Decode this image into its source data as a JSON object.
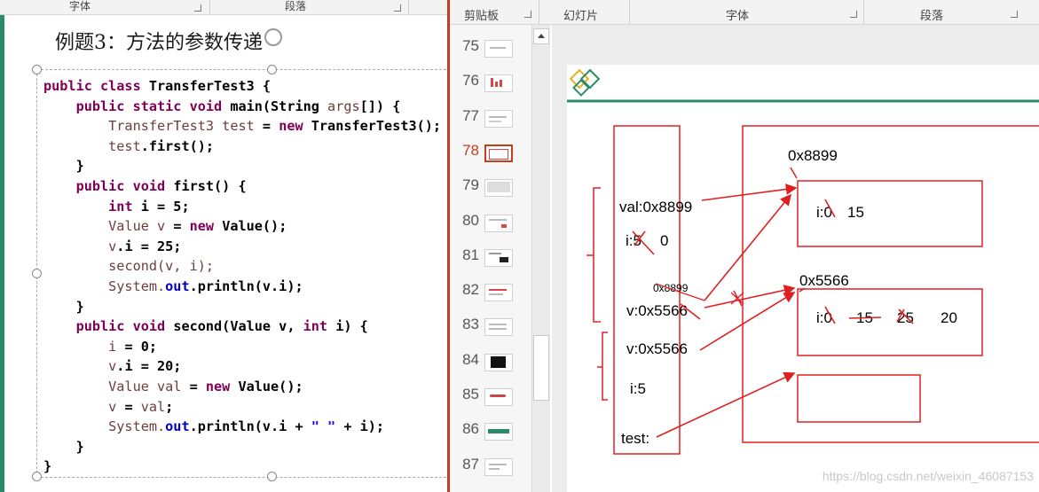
{
  "left": {
    "ribbon": {
      "font_group": "字体",
      "paragraph_group": "段落"
    },
    "title": "例题3：方法的参数传递",
    "code": [
      [
        [
          "k",
          "public class "
        ],
        [
          "n",
          "TransferTest3 {"
        ]
      ],
      [
        [
          "n",
          "    "
        ],
        [
          "k",
          "public static void "
        ],
        [
          "n",
          "main(String "
        ],
        [
          "g",
          "args"
        ],
        [
          "n",
          "[]) {"
        ]
      ],
      [
        [
          "g",
          "        TransferTest3 "
        ],
        [
          "g",
          "test"
        ],
        [
          "n",
          " = "
        ],
        [
          "k",
          "new "
        ],
        [
          "n",
          "TransferTest3();"
        ]
      ],
      [
        [
          "g",
          "        test"
        ],
        [
          "n",
          ".first();"
        ]
      ],
      [
        [
          "n",
          "    }"
        ]
      ],
      [
        [
          "n",
          "    "
        ],
        [
          "k",
          "public void "
        ],
        [
          "n",
          "first() {"
        ]
      ],
      [
        [
          "n",
          "        "
        ],
        [
          "k",
          "int "
        ],
        [
          "n",
          "i = 5;"
        ]
      ],
      [
        [
          "g",
          "        Value "
        ],
        [
          "g",
          "v"
        ],
        [
          "n",
          " = "
        ],
        [
          "k",
          "new "
        ],
        [
          "n",
          "Value();"
        ]
      ],
      [
        [
          "g",
          "        v"
        ],
        [
          "n",
          ".i = 25;"
        ]
      ],
      [
        [
          "n",
          "        "
        ],
        [
          "g",
          "second(v, i);"
        ]
      ],
      [
        [
          "g",
          "        System."
        ],
        [
          "f",
          "out"
        ],
        [
          "n",
          ".println(v.i);"
        ]
      ],
      [
        [
          "n",
          "    }"
        ]
      ],
      [
        [
          "n",
          "    "
        ],
        [
          "k",
          "public void "
        ],
        [
          "n",
          "second(Value v, "
        ],
        [
          "k",
          "int "
        ],
        [
          "n",
          "i) {"
        ]
      ],
      [
        [
          "g",
          "        i"
        ],
        [
          "n",
          " = 0;"
        ]
      ],
      [
        [
          "g",
          "        v"
        ],
        [
          "n",
          ".i = 20;"
        ]
      ],
      [
        [
          "g",
          "        Value "
        ],
        [
          "g",
          "val"
        ],
        [
          "n",
          " = "
        ],
        [
          "k",
          "new "
        ],
        [
          "n",
          "Value();"
        ]
      ],
      [
        [
          "g",
          "        v"
        ],
        [
          "n",
          " = "
        ],
        [
          "g",
          "val"
        ],
        [
          "n",
          ";"
        ]
      ],
      [
        [
          "g",
          "        System."
        ],
        [
          "f",
          "out"
        ],
        [
          "n",
          ".println(v.i + "
        ],
        [
          "s",
          "\" \""
        ],
        [
          "n",
          " + i);"
        ]
      ],
      [
        [
          "n",
          "    }"
        ]
      ],
      [
        [
          "n",
          "}"
        ]
      ]
    ]
  },
  "right": {
    "ribbon": {
      "clipboard": "剪贴板",
      "slides": "幻灯片",
      "font": "字体",
      "paragraph": "段落"
    },
    "thumbnails": [
      "75",
      "76",
      "77",
      "78",
      "79",
      "80",
      "81",
      "82",
      "83",
      "84",
      "85",
      "86",
      "87"
    ],
    "current_slide": "78",
    "slide": {
      "addr_top": "0x8899",
      "addr_mid": "0x5566",
      "addr_small": "0x8899",
      "val_label": "val:0x8899",
      "i5_label": "i:5",
      "zero_label": "0",
      "v_struck_label": "v:0x5566",
      "v_label": "v:0x5566",
      "i5b_label": "i:5",
      "test_label": "test:",
      "obj1_i": "i:0",
      "obj1_val": "15",
      "obj2_i": "i:0",
      "obj2_v15": "15",
      "obj2_v25": "25",
      "obj2_v20": "20"
    },
    "watermark": "https://blog.csdn.net/weixin_46087153"
  },
  "colors": {
    "accent_red": "#c43e1c",
    "ink_red": "#e02020",
    "slide_green": "#2a8a6a"
  }
}
